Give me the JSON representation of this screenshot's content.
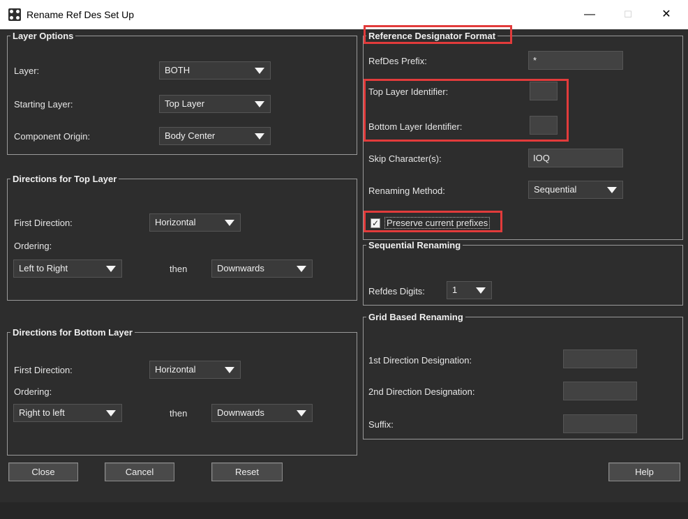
{
  "window": {
    "title": "Rename Ref Des Set Up",
    "minimize": "—",
    "maximize": "☐",
    "close": "✕"
  },
  "layer_options": {
    "legend": "Layer Options",
    "layer_label": "Layer:",
    "layer_value": "BOTH",
    "starting_layer_label": "Starting Layer:",
    "starting_layer_value": "Top Layer",
    "component_origin_label": "Component Origin:",
    "component_origin_value": "Body Center"
  },
  "top_directions": {
    "legend": "Directions for Top Layer",
    "first_direction_label": "First Direction:",
    "first_direction_value": "Horizontal",
    "ordering_label": "Ordering:",
    "ordering_value": "Left to Right",
    "then_label": "then",
    "then_value": "Downwards"
  },
  "bottom_directions": {
    "legend": "Directions for Bottom Layer",
    "first_direction_label": "First Direction:",
    "first_direction_value": "Horizontal",
    "ordering_label": "Ordering:",
    "ordering_value": "Right to left",
    "then_label": "then",
    "then_value": "Downwards"
  },
  "refdes_format": {
    "legend": "Reference Designator Format",
    "prefix_label": "RefDes Prefix:",
    "prefix_value": "*",
    "top_id_label": "Top Layer Identifier:",
    "top_id_value": "",
    "bottom_id_label": "Bottom Layer Identifier:",
    "bottom_id_value": "",
    "skip_label": "Skip Character(s):",
    "skip_value": "IOQ",
    "method_label": "Renaming Method:",
    "method_value": "Sequential",
    "preserve_label": "Preserve current prefixes",
    "preserve_checked": true
  },
  "sequential": {
    "legend": "Sequential Renaming",
    "digits_label": "Refdes Digits:",
    "digits_value": "1"
  },
  "grid": {
    "legend": "Grid Based Renaming",
    "first_label": "1st Direction Designation:",
    "first_value": "",
    "second_label": "2nd Direction Designation:",
    "second_value": "",
    "suffix_label": "Suffix:",
    "suffix_value": ""
  },
  "buttons": {
    "close": "Close",
    "cancel": "Cancel",
    "reset": "Reset",
    "help": "Help"
  },
  "colors": {
    "background": "#2d2d2d",
    "highlight": "#e23b3b",
    "border": "#9a9a9a"
  }
}
